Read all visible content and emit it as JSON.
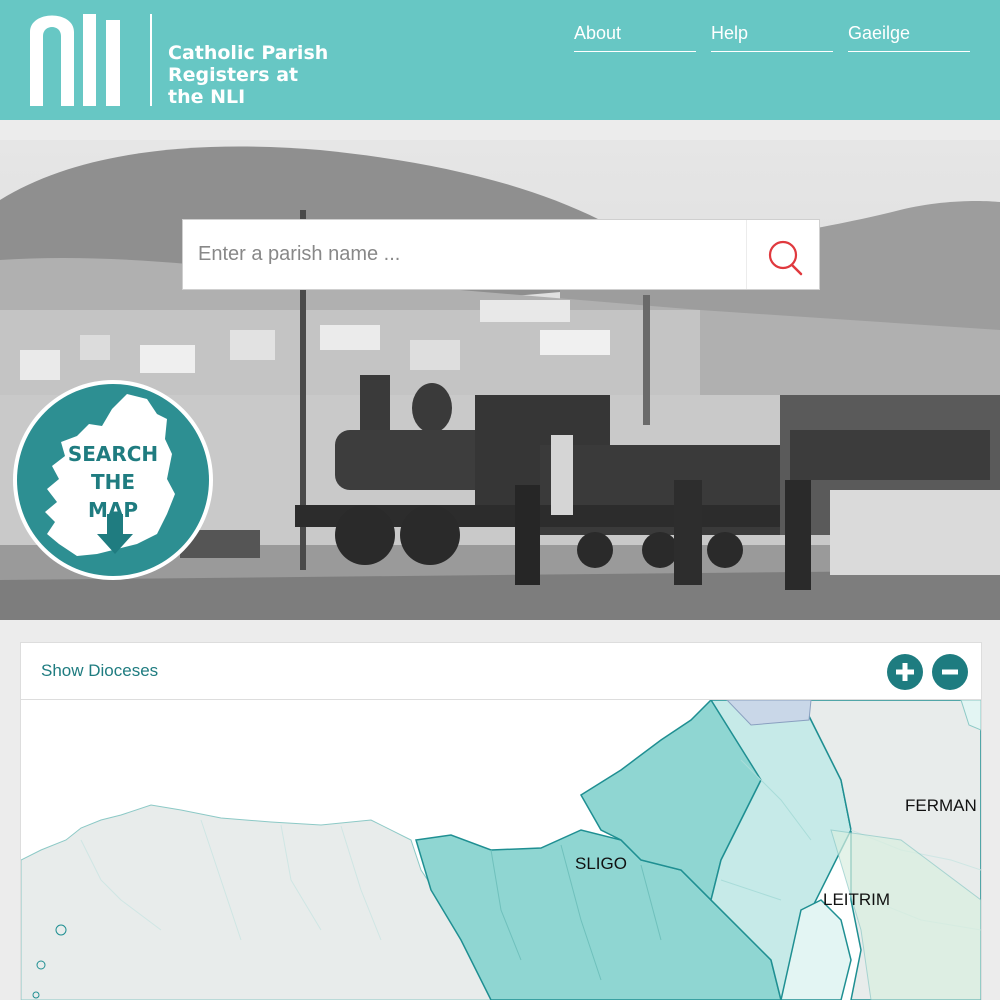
{
  "header": {
    "logo_mark": "nli",
    "title_lines": [
      "Catholic Parish",
      "Registers at",
      "the NLI"
    ],
    "nav": [
      {
        "label": "About"
      },
      {
        "label": "Help"
      },
      {
        "label": "Gaeilge"
      }
    ]
  },
  "search": {
    "placeholder": "Enter a parish name ...",
    "icon": "search-icon"
  },
  "map_badge": {
    "lines": [
      "SEARCH",
      "THE",
      "MAP"
    ],
    "icon": "arrow-down-icon"
  },
  "map_panel": {
    "toggle_label": "Show Dioceses",
    "zoom_in_icon": "plus-icon",
    "zoom_out_icon": "minus-icon",
    "county_labels": [
      "SLIGO",
      "LEITRIM",
      "FERMAN"
    ]
  },
  "colors": {
    "header_bg": "#67c7c4",
    "accent": "#1e7c80",
    "search_icon": "#e0393e",
    "county_teal": "#8fd6d2",
    "county_light": "#c6eae8",
    "county_grey": "#e8eceb"
  }
}
